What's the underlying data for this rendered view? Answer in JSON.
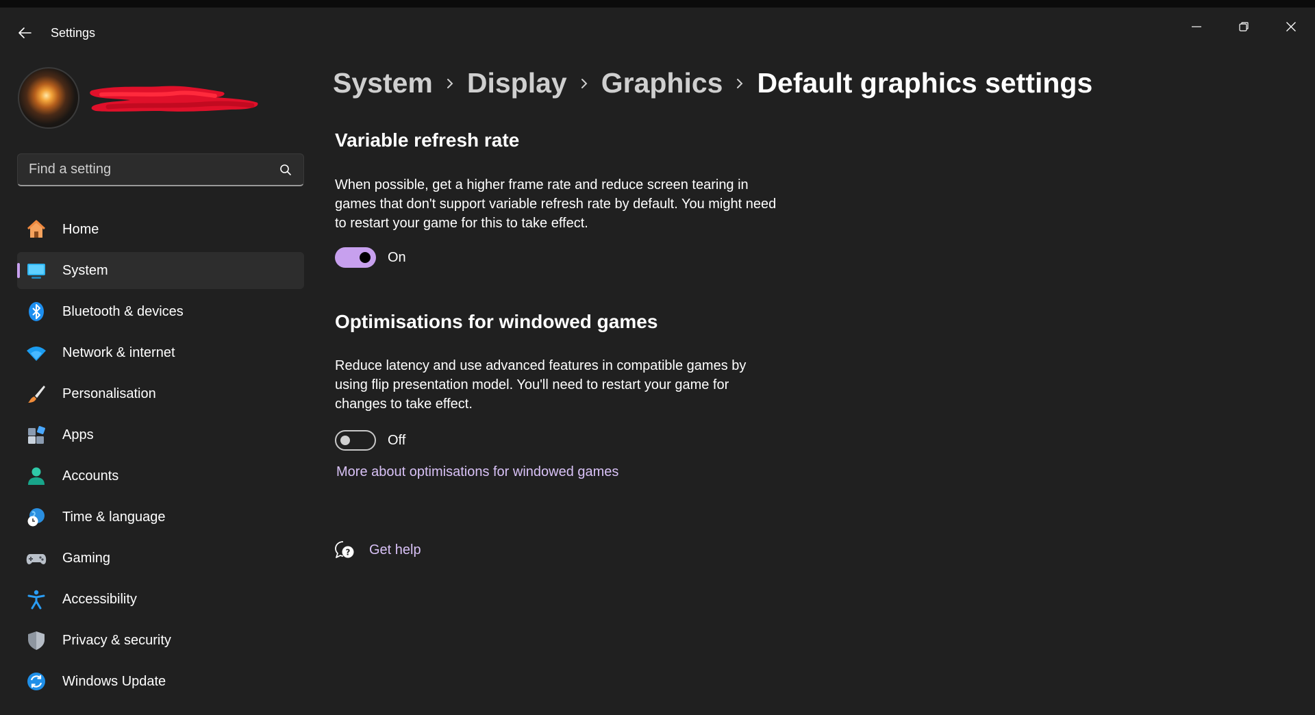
{
  "window": {
    "title": "Settings"
  },
  "search": {
    "placeholder": "Find a setting"
  },
  "sidebar": {
    "items": [
      {
        "label": "Home",
        "icon": "home-icon"
      },
      {
        "label": "System",
        "icon": "system-display-icon",
        "active": true
      },
      {
        "label": "Bluetooth & devices",
        "icon": "bluetooth-icon"
      },
      {
        "label": "Network & internet",
        "icon": "wifi-icon"
      },
      {
        "label": "Personalisation",
        "icon": "paintbrush-icon"
      },
      {
        "label": "Apps",
        "icon": "apps-icon"
      },
      {
        "label": "Accounts",
        "icon": "person-icon"
      },
      {
        "label": "Time & language",
        "icon": "globe-clock-icon"
      },
      {
        "label": "Gaming",
        "icon": "gamepad-icon"
      },
      {
        "label": "Accessibility",
        "icon": "accessibility-icon"
      },
      {
        "label": "Privacy & security",
        "icon": "shield-icon"
      },
      {
        "label": "Windows Update",
        "icon": "sync-icon"
      }
    ]
  },
  "breadcrumb": [
    "System",
    "Display",
    "Graphics",
    "Default graphics settings"
  ],
  "sections": {
    "vrr": {
      "title": "Variable refresh rate",
      "description": "When possible, get a higher frame rate and reduce screen tearing in games that don't support variable refresh rate by default. You might need to restart your game for this to take effect.",
      "toggle_state": "On",
      "enabled": true
    },
    "windowed": {
      "title": "Optimisations for windowed games",
      "description": "Reduce latency and use advanced features in compatible games by using flip presentation model. You'll need to restart your game for changes to take effect.",
      "toggle_state": "Off",
      "enabled": false,
      "link": "More about optimisations for windowed games"
    }
  },
  "help": {
    "label": "Get help"
  },
  "colors": {
    "accent": "#c7a0ee",
    "link": "#d9c2f7",
    "background": "#202020"
  }
}
